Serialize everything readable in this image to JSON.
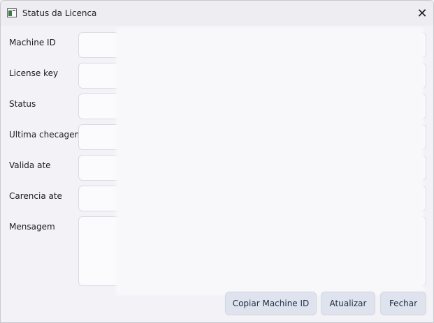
{
  "window": {
    "title": "Status da Licenca",
    "close_glyph": "✕"
  },
  "form": {
    "rows": [
      {
        "label": "Machine ID",
        "value": ""
      },
      {
        "label": "License key",
        "value": ""
      },
      {
        "label": "Status",
        "value": ""
      },
      {
        "label": "Ultima checagem",
        "value": ""
      },
      {
        "label": "Valida ate",
        "value": ""
      },
      {
        "label": "Carencia ate",
        "value": ""
      },
      {
        "label": "Mensagem",
        "value": ""
      }
    ]
  },
  "buttons": {
    "copy_machine_id": "Copiar Machine ID",
    "refresh": "Atualizar",
    "close": "Fechar"
  }
}
